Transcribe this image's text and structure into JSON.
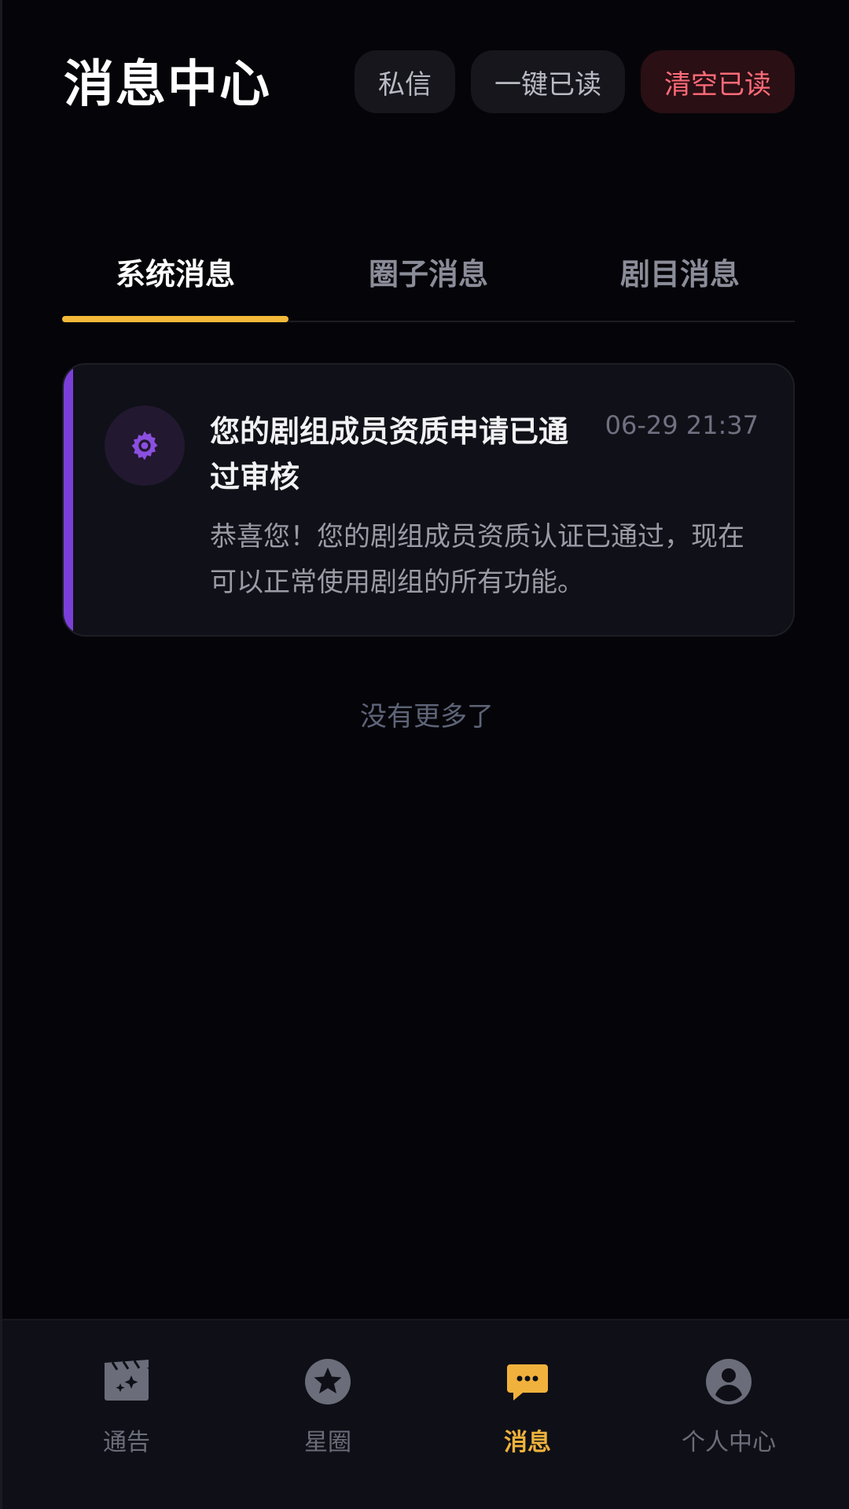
{
  "header": {
    "title": "消息中心",
    "buttons": {
      "dm": "私信",
      "read_all": "一键已读",
      "clear_read": "清空已读"
    }
  },
  "tabs": [
    {
      "label": "系统消息",
      "active": true
    },
    {
      "label": "圈子消息",
      "active": false
    },
    {
      "label": "剧目消息",
      "active": false
    }
  ],
  "messages": [
    {
      "icon": "gear-icon",
      "title": "您的剧组成员资质申请已通过审核",
      "time": "06-29 21:37",
      "body": "恭喜您！您的剧组成员资质认证已通过，现在可以正常使用剧组的所有功能。"
    }
  ],
  "list_end_text": "没有更多了",
  "bottom_nav": [
    {
      "label": "通告",
      "icon": "clapperboard-icon",
      "active": false
    },
    {
      "label": "星圈",
      "icon": "star-icon",
      "active": false
    },
    {
      "label": "消息",
      "icon": "chat-icon",
      "active": true
    },
    {
      "label": "个人中心",
      "icon": "user-icon",
      "active": false
    }
  ],
  "colors": {
    "background": "#050509",
    "accent_yellow": "#f5b93a",
    "danger": "#ff6b78",
    "card_accent_purple": "#7b3fd9"
  }
}
